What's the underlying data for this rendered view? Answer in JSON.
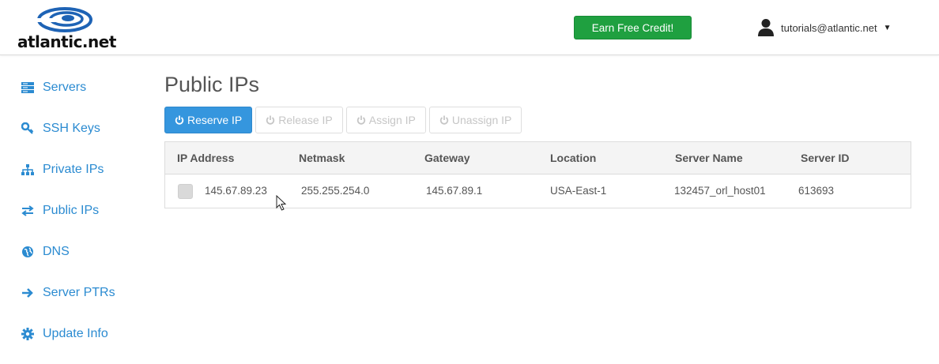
{
  "header": {
    "logo_text": "atlantic.net",
    "earn_credit_label": "Earn Free Credit!",
    "user_email": "tutorials@atlantic.net",
    "user_caret": "▼"
  },
  "sidebar": {
    "items": [
      {
        "label": "Servers",
        "icon": "servers-icon"
      },
      {
        "label": "SSH Keys",
        "icon": "key-icon"
      },
      {
        "label": "Private IPs",
        "icon": "sitemap-icon"
      },
      {
        "label": "Public IPs",
        "icon": "exchange-icon"
      },
      {
        "label": "DNS",
        "icon": "globe-icon"
      },
      {
        "label": "Server PTRs",
        "icon": "arrow-right-icon"
      },
      {
        "label": "Update Info",
        "icon": "gear-icon"
      }
    ]
  },
  "main": {
    "title": "Public IPs",
    "toolbar": {
      "reserve": "Reserve IP",
      "release": "Release IP",
      "assign": "Assign IP",
      "unassign": "Unassign IP"
    },
    "table": {
      "columns": [
        "IP Address",
        "Netmask",
        "Gateway",
        "Location",
        "Server Name",
        "Server ID"
      ],
      "rows": [
        {
          "ip": "145.67.89.23",
          "netmask": "255.255.254.0",
          "gateway": "145.67.89.1",
          "location": "USA-East-1",
          "server_name": "132457_orl_host01",
          "server_id": "613693"
        }
      ]
    }
  },
  "colors": {
    "accent": "#2b8bd1",
    "primary_button": "#3596de",
    "earn_button": "#1fa040",
    "logo_blue": "#1e63b5"
  }
}
